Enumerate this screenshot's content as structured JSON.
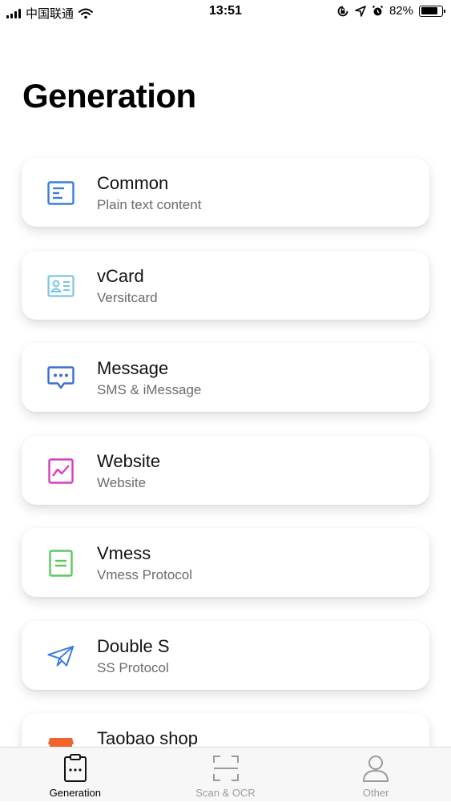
{
  "status_bar": {
    "carrier": "中国联通",
    "time": "13:51",
    "battery_text": "82%",
    "battery_level": 0.82
  },
  "page": {
    "title": "Generation"
  },
  "cards": [
    {
      "title": "Common",
      "subtitle": "Plain text content",
      "icon": "text-document-icon",
      "color": "#3b7ddd"
    },
    {
      "title": "vCard",
      "subtitle": "Versitcard",
      "icon": "contact-card-icon",
      "color": "#7cc3ea"
    },
    {
      "title": "Message",
      "subtitle": "SMS & iMessage",
      "icon": "chat-bubble-icon",
      "color": "#3a6fcf"
    },
    {
      "title": "Website",
      "subtitle": "Website",
      "icon": "chart-line-icon",
      "color": "#d63fc2"
    },
    {
      "title": "Vmess",
      "subtitle": "Vmess Protocol",
      "icon": "document-lines-icon",
      "color": "#5cc85c"
    },
    {
      "title": "Double S",
      "subtitle": "SS Protocol",
      "icon": "paper-plane-icon",
      "color": "#3b7ddd"
    },
    {
      "title": "Taobao shop",
      "subtitle": "",
      "icon": "shop-icon",
      "color": "#f0632b"
    }
  ],
  "tabs": [
    {
      "label": "Generation",
      "icon": "clipboard-icon",
      "active": true
    },
    {
      "label": "Scan & OCR",
      "icon": "scan-frame-icon",
      "active": false
    },
    {
      "label": "Other",
      "icon": "person-icon",
      "active": false
    }
  ]
}
